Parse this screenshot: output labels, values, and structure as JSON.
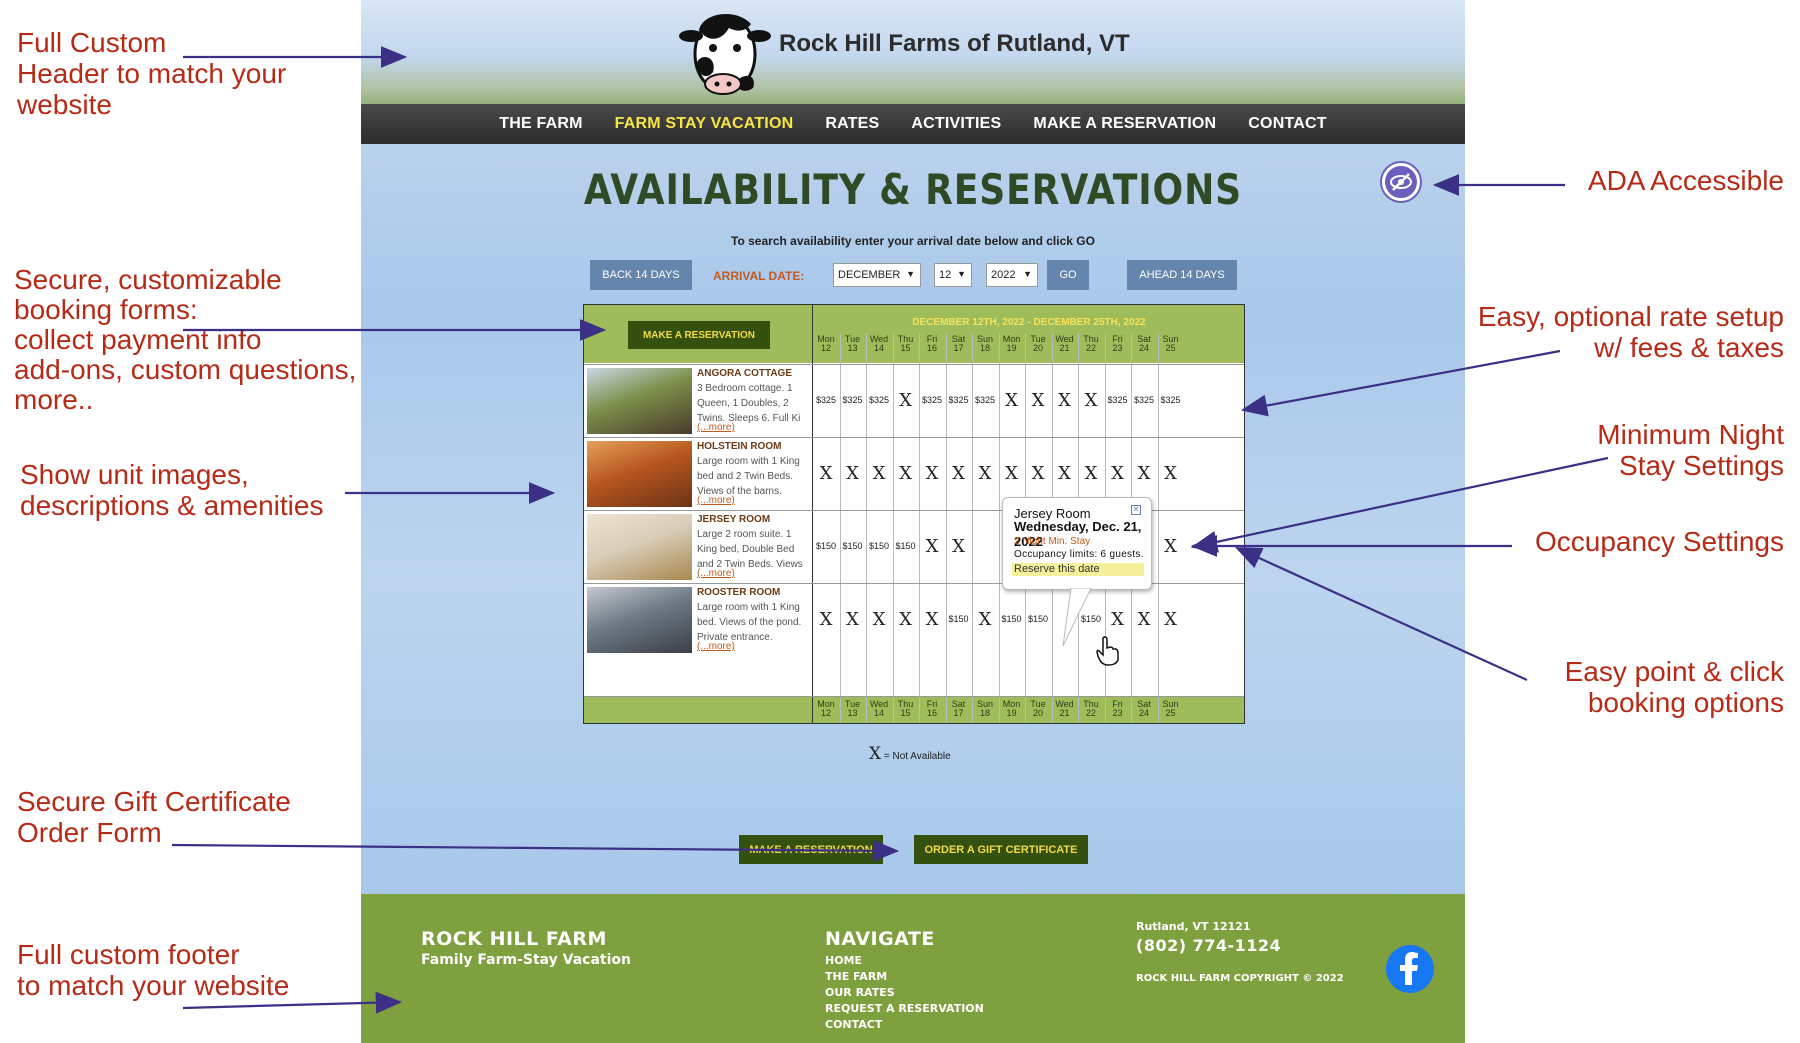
{
  "annotations": {
    "header": "Full Custom\nHeader to match your\nwebsite",
    "forms": "Secure, customizable\nbooking forms:\ncollect payment info\nadd-ons, custom questions,\nmore..",
    "images": "Show unit images,\ndescriptions & amenities",
    "gift": "Secure Gift Certificate\nOrder Form",
    "footer": "Full custom footer\nto match your website",
    "ada": "ADA Accessible",
    "rates": "Easy, optional rate setup\nw/ fees & taxes",
    "minnight": "Minimum Night\nStay Settings",
    "occupancy": "Occupancy Settings",
    "point": "Easy point & click\nbooking options"
  },
  "site": {
    "brand": "Rock Hill Farms of Rutland, VT",
    "nav": [
      "THE FARM",
      "FARM STAY VACATION",
      "RATES",
      "ACTIVITIES",
      "MAKE A RESERVATION",
      "CONTACT"
    ],
    "active_nav": "FARM STAY VACATION",
    "title": "AVAILABILITY & RESERVATIONS",
    "instructions": "To search availability enter your arrival date below and click GO",
    "back_btn": "BACK 14 DAYS",
    "arrival_label": "ARRIVAL DATE:",
    "month": "DECEMBER",
    "day": "12",
    "year": "2022",
    "go_btn": "GO",
    "ahead_btn": "AHEAD 14 DAYS"
  },
  "grid": {
    "make_reservation": "MAKE A RESERVATION",
    "range": "DECEMBER 12TH, 2022 - DECEMBER 25TH, 2022",
    "days": [
      [
        "Mon",
        "12"
      ],
      [
        "Tue",
        "13"
      ],
      [
        "Wed",
        "14"
      ],
      [
        "Thu",
        "15"
      ],
      [
        "Fri",
        "16"
      ],
      [
        "Sat",
        "17"
      ],
      [
        "Sun",
        "18"
      ],
      [
        "Mon",
        "19"
      ],
      [
        "Tue",
        "20"
      ],
      [
        "Wed",
        "21"
      ],
      [
        "Thu",
        "22"
      ],
      [
        "Fri",
        "23"
      ],
      [
        "Sat",
        "24"
      ],
      [
        "Sun",
        "25"
      ]
    ],
    "units": [
      {
        "name": "ANGORA COTTAGE",
        "desc": "3 Bedroom cottage. 1 Queen, 1 Doubles, 2 Twins. Sleeps 6. Full Ki",
        "more": "(...more)",
        "cells": [
          "$325",
          "$325",
          "$325",
          "X",
          "$325",
          "$325",
          "$325",
          "X",
          "X",
          "X",
          "X",
          "$325",
          "$325",
          "$325"
        ]
      },
      {
        "name": "HOLSTEIN ROOM",
        "desc": "Large room with 1 King bed and 2 Twin Beds. Views of the barns.",
        "more": "(...more)",
        "cells": [
          "X",
          "X",
          "X",
          "X",
          "X",
          "X",
          "X",
          "X",
          "X",
          "X",
          "X",
          "X",
          "X",
          "X"
        ]
      },
      {
        "name": "JERSEY ROOM",
        "desc": "Large 2 room suite. 1 King bed, Double Bed and 2 Twin Beds. Views",
        "more": "(...more)",
        "cells": [
          "$150",
          "$150",
          "$150",
          "$150",
          "X",
          "X",
          "",
          "",
          "",
          "",
          "",
          "",
          "",
          "X"
        ]
      },
      {
        "name": "ROOSTER ROOM",
        "desc": "Large room with 1 King bed. Views of the pond. Private entrance.",
        "more": "(...more)",
        "cells": [
          "X",
          "X",
          "X",
          "X",
          "X",
          "$150",
          "X",
          "$150",
          "$150",
          "",
          "$150",
          "X",
          "X",
          "X"
        ]
      }
    ]
  },
  "tooltip": {
    "room": "Jersey Room",
    "date": "Wednesday, Dec. 21, 2022",
    "min_stay": "2 Night Min. Stay",
    "occupancy": "Occupancy limits: 6 guests.",
    "reserve": "Reserve this date"
  },
  "legend": {
    "symbol": "X",
    "text": "= Not Available"
  },
  "bottom": {
    "make_reservation": "MAKE A RESERVATION",
    "gift": "ORDER A GIFT CERTIFICATE"
  },
  "footer": {
    "name": "ROCK HILL FARM",
    "tagline": "Family Farm-Stay Vacation",
    "nav_title": "NAVIGATE",
    "links": [
      "HOME",
      "THE FARM",
      "OUR RATES",
      "REQUEST A RESERVATION",
      "CONTACT"
    ],
    "city": "Rutland, VT 12121",
    "phone": "(802) 774-1124",
    "copyright": "ROCK HILL FARM COPYRIGHT © 2022"
  },
  "colors": {
    "annotation": "#b62a16",
    "arrow": "#3c2f86",
    "nav_active": "#f6e646",
    "grid_header": "#9ebd5a",
    "footer": "#7ea03e",
    "dark_button": "#34510f"
  },
  "icons": {
    "ada": "eye-slash-icon",
    "social": "facebook-icon",
    "logo": "cow-head-icon",
    "cursor": "hand-pointer-icon"
  }
}
